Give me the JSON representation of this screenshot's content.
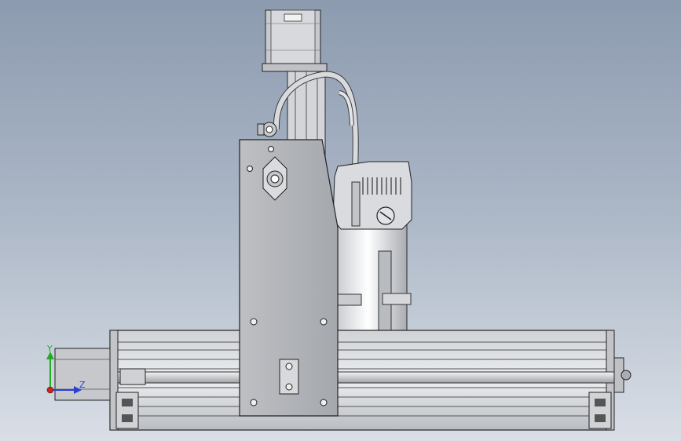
{
  "view": {
    "background_top": "#8d9bb0",
    "background_bottom": "#d9dee6"
  },
  "triad": {
    "y_label": "Y",
    "z_label": "Z",
    "y_color": "#1fae1f",
    "z_color": "#2a3fd6",
    "x_color": "#d02020"
  },
  "icons": [
    "stepper-motor",
    "linear-rail",
    "spindle-motor",
    "aluminium-extrusion",
    "coordinate-triad"
  ]
}
